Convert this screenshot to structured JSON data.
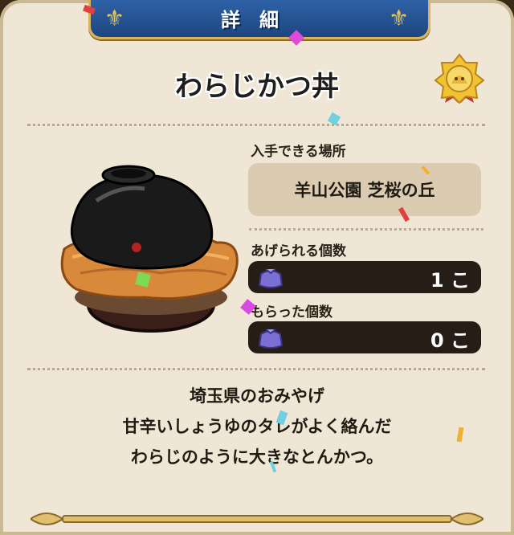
{
  "header": {
    "title": "詳細"
  },
  "item": {
    "name": "わらじかつ丼"
  },
  "acquire": {
    "label": "入手できる場所",
    "location": "羊山公園 芝桜の丘"
  },
  "giftable": {
    "label": "あげられる個数",
    "value": "1 こ"
  },
  "received": {
    "label": "もらった個数",
    "value": "0 こ"
  },
  "description": {
    "line1": "埼玉県のおみやげ",
    "line2": "甘辛いしょうゆのタレがよく絡んだ",
    "line3": "わらじのように大きなとんかつ。"
  },
  "colors": {
    "panel": "#efe6d6",
    "header_blue": "#2f63a8",
    "gold": "#d9b45a",
    "pill": "#261e16",
    "location_box": "#dacbb1"
  },
  "icons": {
    "medal": "slime-medal-icon",
    "gift": "gift-bag-icon"
  }
}
